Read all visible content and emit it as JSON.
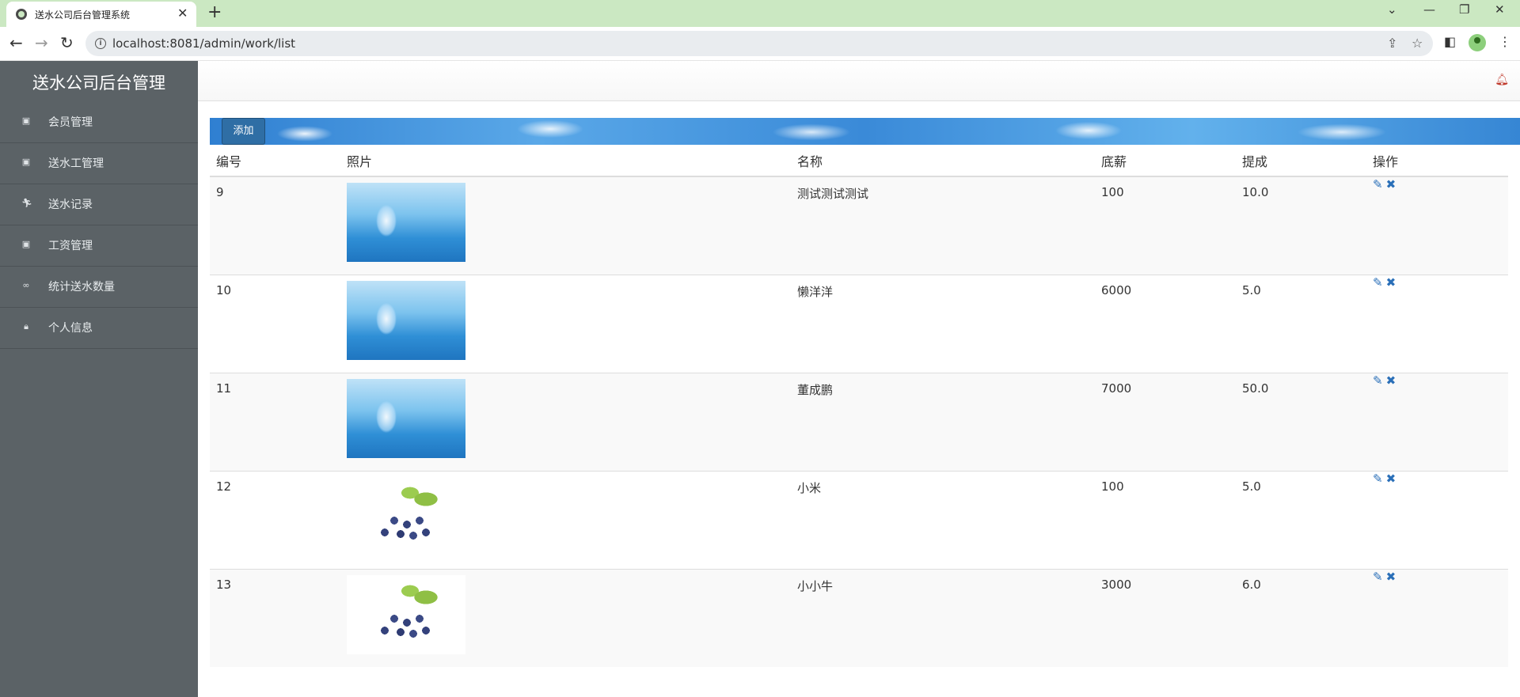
{
  "browser": {
    "tab_title": "送水公司后台管理系统",
    "url": "localhost:8081/admin/work/list"
  },
  "sidebar": {
    "brand": "送水公司后台管理",
    "items": [
      {
        "label": "会员管理",
        "icon": "list-alt-icon"
      },
      {
        "label": "送水工管理",
        "icon": "list-alt-icon"
      },
      {
        "label": "送水记录",
        "icon": "running-icon"
      },
      {
        "label": "工资管理",
        "icon": "list-alt-icon"
      },
      {
        "label": "统计送水数量",
        "icon": "voicemail-icon"
      },
      {
        "label": "个人信息",
        "icon": "lock-icon"
      }
    ]
  },
  "toolbar": {
    "add_label": "添加"
  },
  "table": {
    "headers": [
      "编号",
      "照片",
      "名称",
      "底薪",
      "提成",
      "操作"
    ],
    "rows": [
      {
        "id": "9",
        "photo": "water-bottle",
        "name": "测试测试测试",
        "base_salary": "100",
        "commission": "10.0"
      },
      {
        "id": "10",
        "photo": "water-bottle",
        "name": "懒洋洋",
        "base_salary": "6000",
        "commission": "5.0"
      },
      {
        "id": "11",
        "photo": "water-bottle",
        "name": "董成鹏",
        "base_salary": "7000",
        "commission": "50.0"
      },
      {
        "id": "12",
        "photo": "grapes",
        "name": "小米",
        "base_salary": "100",
        "commission": "5.0"
      },
      {
        "id": "13",
        "photo": "grapes",
        "name": "小小牛",
        "base_salary": "3000",
        "commission": "6.0"
      }
    ]
  },
  "colors": {
    "sidebar_bg": "#5b6266",
    "accent": "#2f6ea5",
    "tabbar": "#cbe8c2",
    "bell": "#c0392b"
  }
}
